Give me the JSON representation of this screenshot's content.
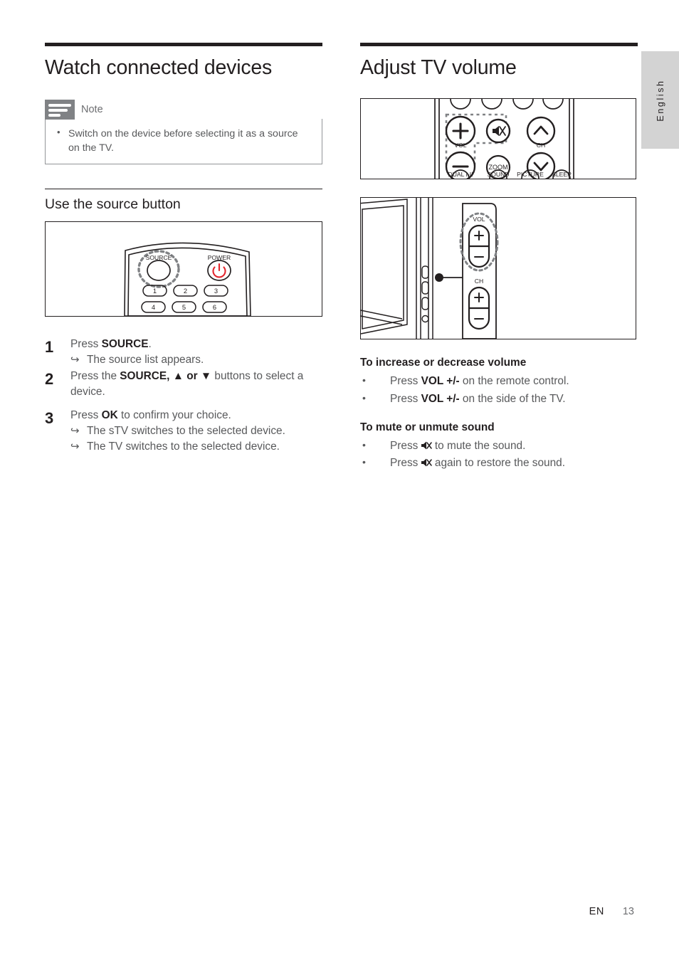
{
  "page": {
    "language_tab": "English",
    "footer_lang_code": "EN",
    "footer_page_number": "13"
  },
  "left_column": {
    "title": "Watch connected devices",
    "note": {
      "label": "Note",
      "icon": "note-lines-icon",
      "items": [
        "Switch on the device before selecting it as a source on the TV."
      ]
    },
    "subsection": {
      "title": "Use the source button",
      "figure": {
        "name": "remote-control-source-power-figure",
        "labels": {
          "source": "SOURCE",
          "power": "POWER",
          "keys": [
            "1",
            "2",
            "3",
            "4",
            "5",
            "6"
          ]
        },
        "power_icon_color": "#e3262d"
      },
      "steps": [
        {
          "num": "1",
          "text_before": "Press ",
          "bold": "SOURCE",
          "text_after": ".",
          "results": [
            "The source list appears."
          ]
        },
        {
          "num": "2",
          "text_before": "Press the ",
          "bold": "SOURCE, ▲ or ▼",
          "text_after": " buttons to select a device.",
          "results": []
        },
        {
          "num": "3",
          "text_before": "Press ",
          "bold": "OK",
          "text_after": " to confirm your choice.",
          "results": [
            "The sTV switches to the selected device.",
            "The TV switches to the selected device."
          ]
        }
      ]
    }
  },
  "right_column": {
    "title": "Adjust TV volume",
    "figure_remote": {
      "name": "remote-control-volume-figure",
      "labels": {
        "vol": "VOL",
        "ch": "CH",
        "zoom": "ZOOM",
        "dual": "DUAL I-II",
        "sound": "SOUND",
        "picture": "PICTURE",
        "sleep": "SLEEP"
      }
    },
    "figure_tv": {
      "name": "tv-side-panel-volume-figure",
      "labels": {
        "vol": "VOL",
        "ch": "CH",
        "plus": "+",
        "minus": "−"
      }
    },
    "blocks": [
      {
        "heading": "To increase or decrease volume",
        "items": [
          {
            "before": "Press ",
            "bold": "VOL +/-",
            "after": " on the remote control.",
            "icon": null
          },
          {
            "before": "Press ",
            "bold": "VOL +/-",
            "after": " on the side of the TV.",
            "icon": null
          }
        ]
      },
      {
        "heading": "To mute or unmute sound",
        "items": [
          {
            "before": "Press ",
            "bold": "",
            "after": " to mute the sound.",
            "icon": "mute-icon"
          },
          {
            "before": "Press ",
            "bold": "",
            "after": " again to restore the sound.",
            "icon": "mute-icon"
          }
        ]
      }
    ]
  }
}
